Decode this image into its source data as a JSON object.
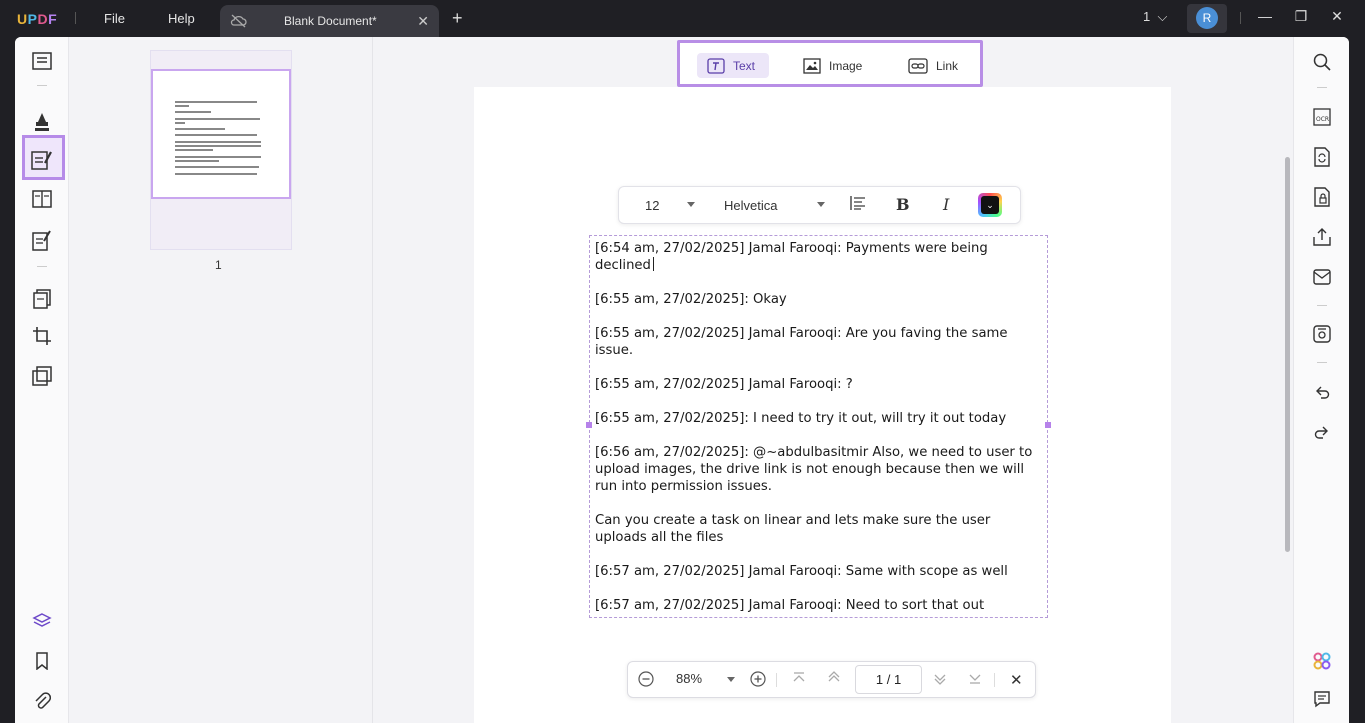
{
  "app": {
    "logo": {
      "u": "U",
      "p": "P",
      "d": "D",
      "f": "F"
    },
    "menu": {
      "file": "File",
      "help": "Help"
    },
    "tab_title": "Blank Document*",
    "page_count": "1"
  },
  "user": {
    "avatar_initial": "R"
  },
  "insert_toolbar": {
    "text_label": "Text",
    "image_label": "Image",
    "link_label": "Link"
  },
  "format_toolbar": {
    "font_size": "12",
    "font_family": "Helvetica",
    "bold": "B",
    "italic": "I",
    "text_color": "#000000"
  },
  "thumbnail": {
    "page_number": "1"
  },
  "document": {
    "lines": [
      "[6:54 am, 27/02/2025] Jamal Farooqi: Payments were being declined",
      "[6:55 am, 27/02/2025]: Okay",
      "[6:55 am, 27/02/2025] Jamal Farooqi: Are you faving the same issue.",
      "[6:55 am, 27/02/2025] Jamal Farooqi: ?",
      "[6:55 am, 27/02/2025]: I need to try it out, will try it out today",
      "[6:56 am, 27/02/2025]: @~abdulbasitmir Also, we need to user to upload images, the drive link is not enough because then we will run into permission issues.",
      "Can you create a task on linear and lets make sure the user uploads all the files",
      "[6:57 am, 27/02/2025] Jamal Farooqi: Same with scope as well",
      "[6:57 am, 27/02/2025] Jamal Farooqi: Need to sort that out"
    ]
  },
  "zoom_toolbar": {
    "zoom": "88%",
    "page_current": "1",
    "page_sep": "/",
    "page_total": "1"
  },
  "colors": {
    "accent": "#b88ee6",
    "title_bg": "#1f1f24"
  }
}
